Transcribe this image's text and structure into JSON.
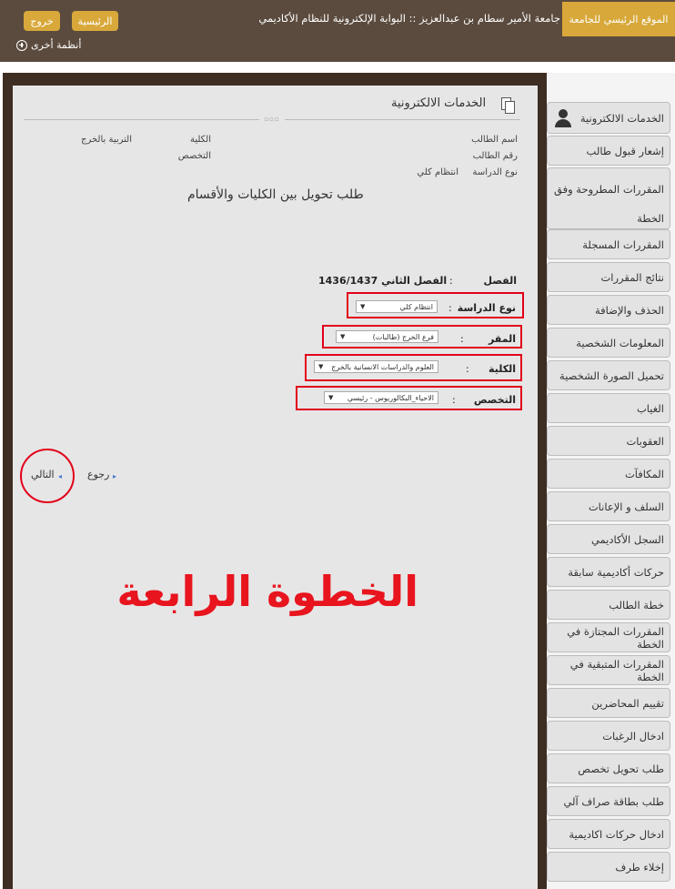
{
  "header": {
    "home_site": "الموقع الرئيسي للجامعة",
    "portal_title": "جامعة الأمير سطام بن عبدالعزيز :: البوابة الإلكترونية للنظام الأكاديمي",
    "main_button": "الرئيسية",
    "exit_button": "خروج",
    "other_systems": "أنظمة أخرى",
    "other_systems_icon": "plus-circle-icon"
  },
  "section": {
    "title": "الخدمات الالكترونية",
    "title_icon": "documents-icon"
  },
  "student": {
    "name_label": "اسم الطالب",
    "id_label": "رقم الطالب",
    "study_type_label": "نوع الدراسة",
    "study_type_value": "انتظام كلي",
    "college_label": "الكلية",
    "college_value": "التربية بالخرج",
    "major_label": "التخصص"
  },
  "request_title": "طلب تحويل بين الكليات والأقسام",
  "form": {
    "semester_label": "الفصل",
    "semester_value": "الفصل الثاني 1436/1437",
    "study_type_label": "نوع الدراسة",
    "study_type_select": "انتظام كلي",
    "location_label": "المقر",
    "location_select": "فرع الخرج (طالبات)",
    "college_label": "الكلية",
    "college_select": "العلوم والدراسات الانسانية بالخرج",
    "major_label": "التخصص",
    "major_select": "الاحياء_البكالوريوس - رئيسي",
    "colon": ":"
  },
  "nav": {
    "back": "رجوع",
    "next": "التالي"
  },
  "step_label": "الخطوة الرابعة",
  "sidebar": {
    "header_icon": "user-icon",
    "items": [
      "الخدمات الالكترونية",
      "إشعار قبول طالب",
      "المقررات المطروحة وفق الخطة",
      "المقررات المسجلة",
      "نتائج المقررات",
      "الحذف والإضافة",
      "المعلومات الشخصية",
      "تحميل الصورة الشخصية",
      "الغياب",
      "العقوبات",
      "المكافآت",
      "السلف و الإعانات",
      "السجل الأكاديمي",
      "حركات أكاديمية سابقة",
      "خطة الطالب",
      "المقررات المجتازة في الخطة",
      "المقررات المتبقية في الخطة",
      "تقييم المحاضرين",
      "ادخال الرغبات",
      "طلب تحويل تخصص",
      "طلب بطاقة صراف آلي",
      "ادخال حركات اكاديمية",
      "إخلاء طرف"
    ]
  },
  "colors": {
    "header_bg": "#5b4b3e",
    "accent": "#d8a83a",
    "highlight_red": "#e2001a",
    "frame_dark": "#3e2d22",
    "panel_bg": "#e6e6e6"
  }
}
